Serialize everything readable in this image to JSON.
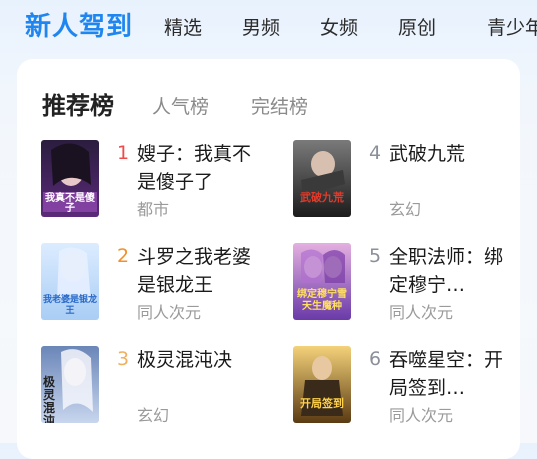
{
  "top_tabs": [
    "新人驾到",
    "精选",
    "男频",
    "女频",
    "原创",
    "青少年"
  ],
  "card": {
    "tabs": [
      "推荐榜",
      "人气榜",
      "完结榜"
    ]
  },
  "books": [
    {
      "rank": "1",
      "title": "嫂子：我真不是傻子了",
      "genre": "都市",
      "cover_text": "我真不是傻子",
      "rank_color": "#f04a4a"
    },
    {
      "rank": "2",
      "title": "斗罗之我老婆是银龙王",
      "genre": "同人次元",
      "cover_text": "我老婆是银龙王",
      "rank_color": "#f0912a"
    },
    {
      "rank": "3",
      "title": "极灵混沌决",
      "genre": "玄幻",
      "cover_text": "极灵混沌",
      "rank_color": "#f0b060"
    },
    {
      "rank": "4",
      "title": "武破九荒",
      "genre": "玄幻",
      "cover_text": "武破九荒",
      "rank_color": "#8a8f9a"
    },
    {
      "rank": "5",
      "title": "全职法师：绑定穆宁…",
      "genre": "同人次元",
      "cover_text": "绑定穆宁雪 天生魔种",
      "rank_color": "#8a8f9a"
    },
    {
      "rank": "6",
      "title": "吞噬星空：开局签到…",
      "genre": "同人次元",
      "cover_text": "开局签到",
      "rank_color": "#8a8f9a"
    }
  ],
  "colors": {
    "accent": "#1f86f0",
    "rank1": "#f04a4a",
    "rank2": "#f0912a",
    "rank3": "#f0b060"
  }
}
